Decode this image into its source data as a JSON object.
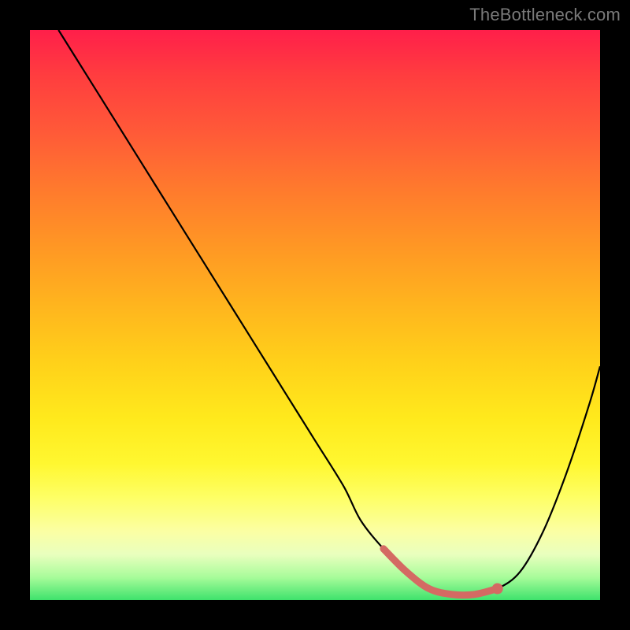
{
  "watermark": "TheBottleneck.com",
  "colors": {
    "background": "#000000",
    "watermark": "#7a7a7a",
    "curve": "#000000",
    "highlight": "#d46a63",
    "highlight_dot": "#d46a63"
  },
  "chart_data": {
    "type": "line",
    "title": "",
    "xlabel": "",
    "ylabel": "",
    "xlim": [
      0,
      100
    ],
    "ylim": [
      0,
      100
    ],
    "grid": false,
    "legend": false,
    "background_gradient": "ideal-zone heatmap (red=high bottleneck, green=ideal)",
    "series": [
      {
        "name": "bottleneck-curve",
        "x": [
          5,
          10,
          15,
          20,
          25,
          30,
          35,
          40,
          45,
          50,
          55,
          58,
          62,
          66,
          70,
          74,
          78,
          82,
          86,
          90,
          94,
          98,
          100
        ],
        "y": [
          100,
          92,
          84,
          76,
          68,
          60,
          52,
          44,
          36,
          28,
          20,
          14,
          9,
          5,
          2,
          1,
          1,
          2,
          5,
          12,
          22,
          34,
          41
        ]
      }
    ],
    "highlight_segment": {
      "name": "optimal-range",
      "x": [
        62,
        66,
        70,
        74,
        78,
        82
      ],
      "y": [
        9,
        5,
        2,
        1,
        1,
        2
      ]
    },
    "highlight_point": {
      "x": 82,
      "y": 2
    }
  }
}
